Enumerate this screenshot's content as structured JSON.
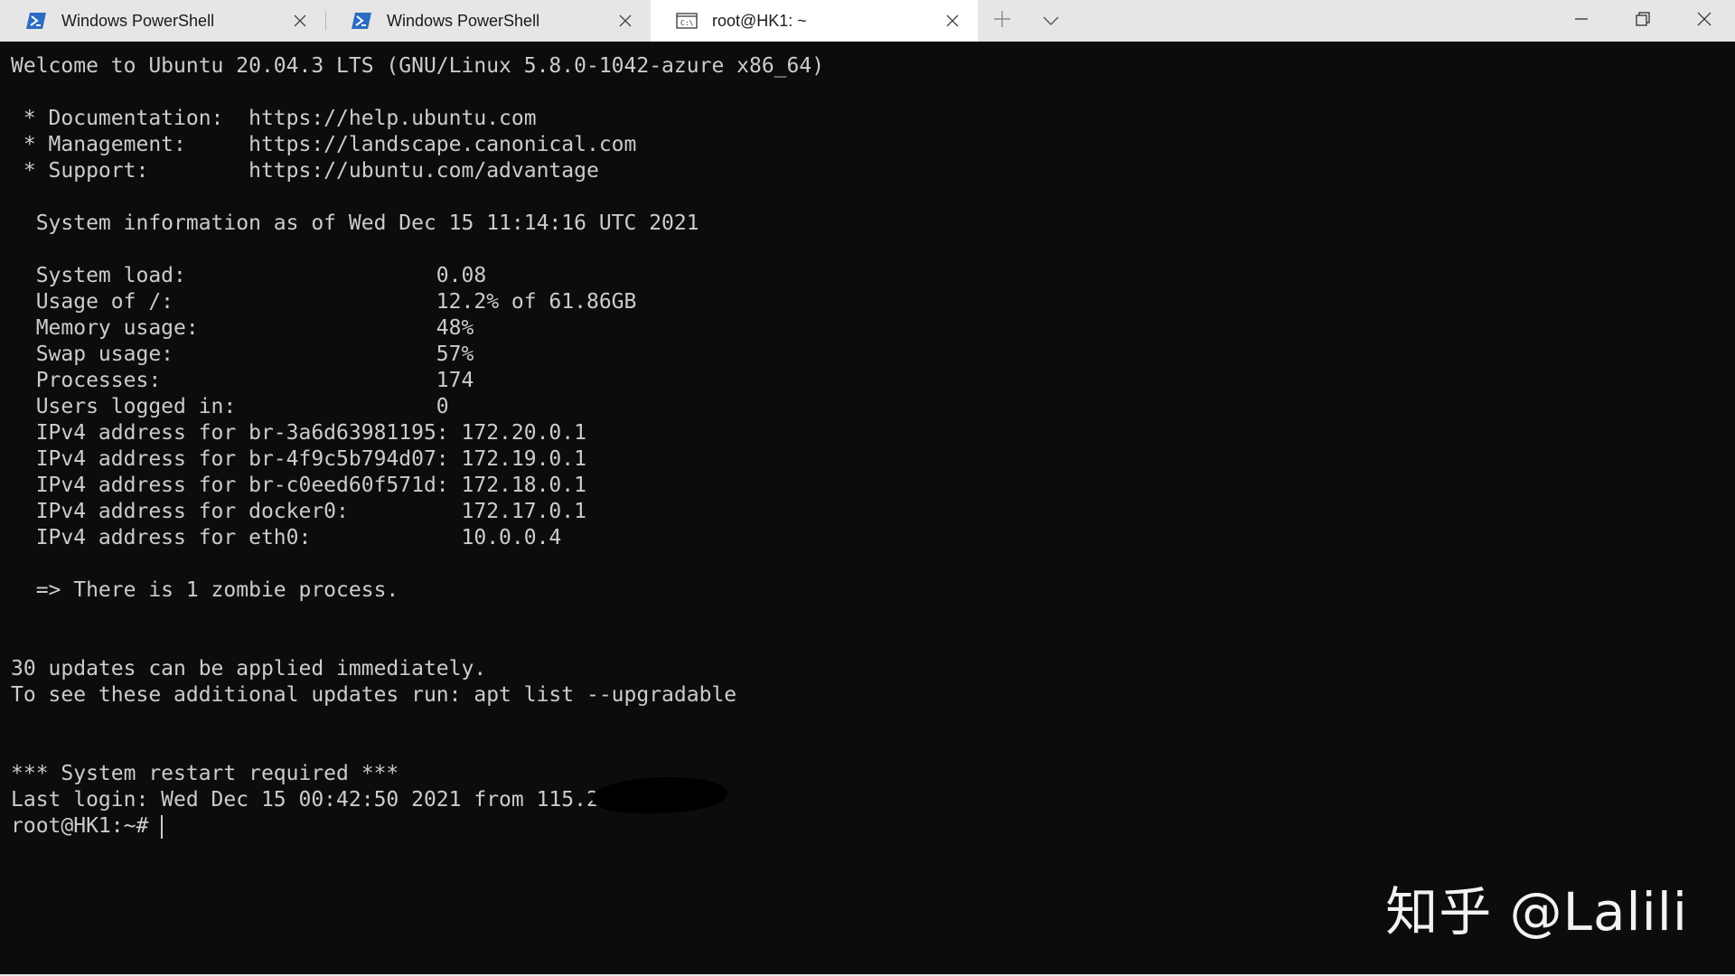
{
  "tabs": [
    {
      "title": "Windows PowerShell",
      "icon": "powershell-icon",
      "active": false
    },
    {
      "title": "Windows PowerShell",
      "icon": "powershell-icon",
      "active": false
    },
    {
      "title": "root@HK1: ~",
      "icon": "console-icon",
      "active": true
    }
  ],
  "terminal": {
    "lines": [
      "Welcome to Ubuntu 20.04.3 LTS (GNU/Linux 5.8.0-1042-azure x86_64)",
      "",
      " * Documentation:  https://help.ubuntu.com",
      " * Management:     https://landscape.canonical.com",
      " * Support:        https://ubuntu.com/advantage",
      "",
      "  System information as of Wed Dec 15 11:14:16 UTC 2021",
      "",
      "  System load:                    0.08",
      "  Usage of /:                     12.2% of 61.86GB",
      "  Memory usage:                   48%",
      "  Swap usage:                     57%",
      "  Processes:                      174",
      "  Users logged in:                0",
      "  IPv4 address for br-3a6d63981195: 172.20.0.1",
      "  IPv4 address for br-4f9c5b794d07: 172.19.0.1",
      "  IPv4 address for br-c0eed60f571d: 172.18.0.1",
      "  IPv4 address for docker0:         172.17.0.1",
      "  IPv4 address for eth0:            10.0.0.4",
      "",
      "  => There is 1 zombie process.",
      "",
      "",
      "30 updates can be applied immediately.",
      "To see these additional updates run: apt list --upgradable",
      "",
      "",
      "*** System restart required ***",
      "Last login: Wed Dec 15 00:42:50 2021 from 115.2."
    ],
    "prompt": "root@HK1:~#"
  },
  "watermark": "知乎 @Lalili",
  "colors": {
    "background": "#0c0c0c",
    "foreground": "#cccccc",
    "tabbar": "#e6e6e6",
    "active_tab": "#ffffff",
    "powershell_icon": "#2b6cc4"
  }
}
